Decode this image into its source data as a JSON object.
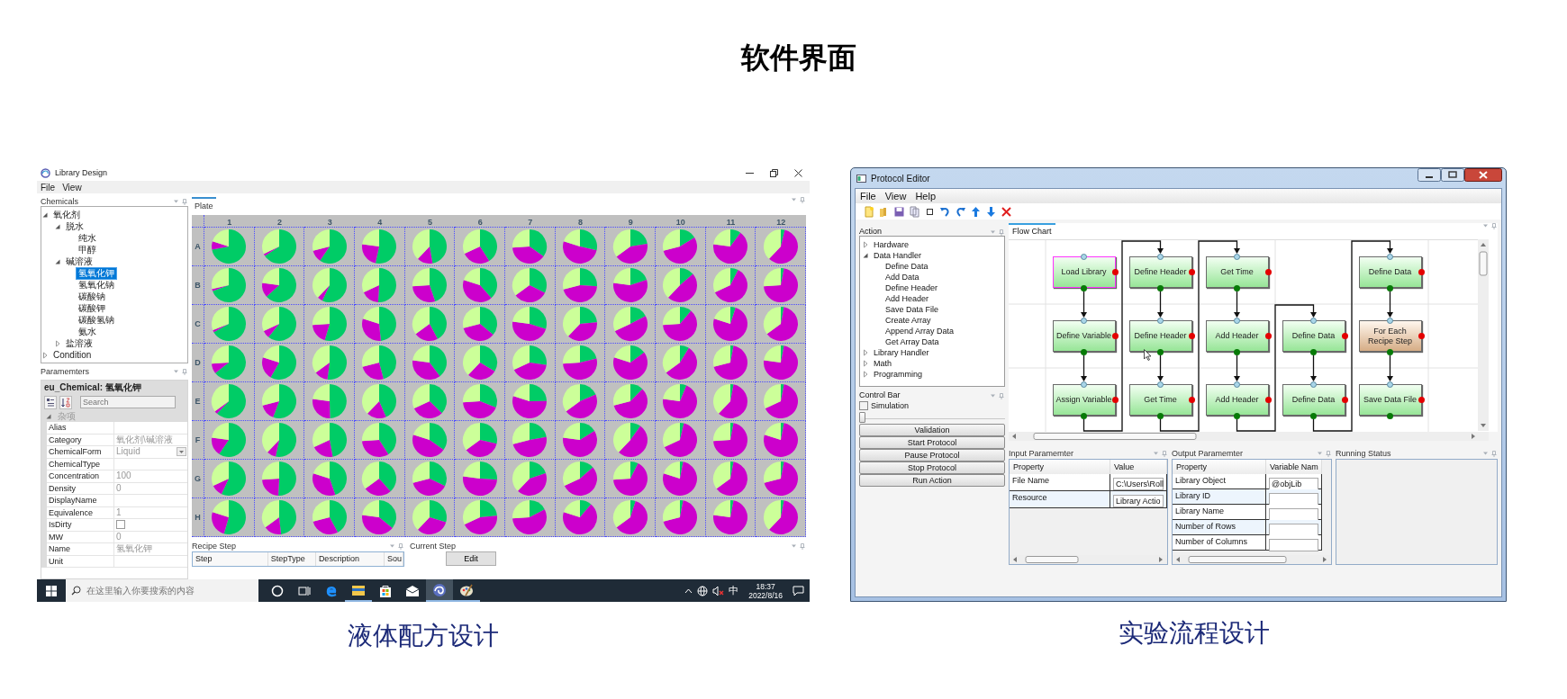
{
  "title": "软件界面",
  "library_design": {
    "window": {
      "title": "Library Design"
    },
    "menu": [
      "File",
      "View"
    ],
    "chemicals": {
      "title": "Chemicals",
      "tree": [
        {
          "label": "氧化剂",
          "expanded": true,
          "selected": false,
          "children": [
            {
              "label": "脱水",
              "expanded": true,
              "selected": false,
              "children": [
                {
                  "label": "纯水",
                  "selected": false
                },
                {
                  "label": "甲醇",
                  "selected": false
                }
              ]
            },
            {
              "label": "碱溶液",
              "expanded": true,
              "selected": false,
              "children": [
                {
                  "label": "氢氧化钾",
                  "selected": true
                },
                {
                  "label": "氢氧化钠",
                  "selected": false
                },
                {
                  "label": "碳酸钠",
                  "selected": false
                },
                {
                  "label": "碳酸钾",
                  "selected": false
                },
                {
                  "label": "碳酸氢钠",
                  "selected": false
                },
                {
                  "label": "氨水",
                  "selected": false
                }
              ]
            },
            {
              "label": "盐溶液",
              "expanded": false,
              "selected": false
            }
          ]
        },
        {
          "label": "Condition",
          "expanded": false,
          "selected": false
        }
      ]
    },
    "parameters": {
      "title": "Paramemters",
      "object": "eu_Chemical: 氢氧化钾",
      "search": {
        "placeholder": "Search"
      },
      "category": {
        "label": "杂项",
        "expanded": true
      },
      "rows": [
        {
          "name": "Alias",
          "kind": "text"
        },
        {
          "name": "Category",
          "kind": "text",
          "value": "氧化剂\\碱溶液"
        },
        {
          "name": "ChemicalForm",
          "kind": "dropdown",
          "value": "Liquid"
        },
        {
          "name": "ChemicalType",
          "kind": "text"
        },
        {
          "name": "Concentration",
          "kind": "text",
          "value": "100"
        },
        {
          "name": "Density",
          "kind": "text",
          "value": "0"
        },
        {
          "name": "DisplayName",
          "kind": "text"
        },
        {
          "name": "Equivalence",
          "kind": "text",
          "value": "1"
        },
        {
          "name": "IsDirty",
          "kind": "checkbox",
          "checked": false
        },
        {
          "name": "MW",
          "kind": "text",
          "value": "0"
        },
        {
          "name": "Name",
          "kind": "text",
          "value": "氢氧化钾"
        },
        {
          "name": "Unit",
          "kind": "text"
        }
      ]
    },
    "plate": {
      "tab": "Plate",
      "columns": [
        "1",
        "2",
        "3",
        "4",
        "5",
        "6",
        "7",
        "8",
        "9",
        "10",
        "11",
        "12"
      ],
      "rows": [
        "A",
        "B",
        "C",
        "D",
        "E",
        "F",
        "G",
        "H"
      ]
    },
    "recipe_step": {
      "title": "Recipe Step",
      "columns": [
        "Step",
        "StepType",
        "Description",
        "Sou"
      ]
    },
    "current_step": {
      "title": "Current Step",
      "button": "Edit"
    },
    "taskbar": {
      "search": {
        "placeholder": "在这里输入你要搜索的内容"
      },
      "apps": [
        {
          "kind": "cortana",
          "selected": false,
          "running": false
        },
        {
          "kind": "task-view",
          "selected": false,
          "running": false
        },
        {
          "kind": "browser",
          "selected": false,
          "running": false
        },
        {
          "kind": "folder",
          "selected": false,
          "running": true
        },
        {
          "kind": "store",
          "selected": false,
          "running": false
        },
        {
          "kind": "mail",
          "selected": false,
          "running": false
        },
        {
          "kind": "swirl",
          "selected": true,
          "running": true
        },
        {
          "kind": "paint",
          "selected": false,
          "running": true
        }
      ],
      "ime": "中",
      "time": "18:37",
      "date": "2022/8/16"
    },
    "caption": "液体配方设计"
  },
  "protocol_editor": {
    "window": {
      "title": "Protocol Editor"
    },
    "menu": [
      "File",
      "View",
      "Help"
    ],
    "action": {
      "title": "Action",
      "tree": [
        {
          "label": "Hardware",
          "expanded": false,
          "selected": false
        },
        {
          "label": "Data Handler",
          "expanded": true,
          "selected": false,
          "children": [
            {
              "label": "Define Data",
              "selected": false
            },
            {
              "label": "Add Data",
              "selected": false
            },
            {
              "label": "Define Header",
              "selected": false
            },
            {
              "label": "Add Header",
              "selected": false
            },
            {
              "label": "Save Data File",
              "selected": false
            },
            {
              "label": "Create Array",
              "selected": false
            },
            {
              "label": "Append Array Data",
              "selected": false
            },
            {
              "label": "Get Array Data",
              "selected": false
            }
          ]
        },
        {
          "label": "Library Handler",
          "expanded": false,
          "selected": false
        },
        {
          "label": "Math",
          "expanded": false,
          "selected": false
        },
        {
          "label": "Programming",
          "expanded": false,
          "selected": false
        }
      ]
    },
    "control_bar": {
      "title": "Control Bar",
      "simulation": {
        "label": "Simulation",
        "checked": false
      },
      "slider": {
        "level": 0
      },
      "buttons": [
        "Validation",
        "Start Protocol",
        "Pause Protocol",
        "Stop Protocol",
        "Run Action"
      ]
    },
    "flow_chart": {
      "tab": "Flow Chart",
      "columns": [
        {
          "nodes": [
            {
              "label": "Load Library",
              "kind": "action",
              "selected": true
            },
            {
              "label": "Define Variable",
              "kind": "action",
              "selected": false
            },
            {
              "label": "Assign Variable",
              "kind": "action",
              "selected": false
            }
          ]
        },
        {
          "nodes": [
            {
              "label": "Define Header",
              "kind": "action",
              "selected": false
            },
            {
              "label": "Define Header",
              "kind": "action",
              "selected": false
            },
            {
              "label": "Get Time",
              "kind": "action",
              "selected": false
            }
          ]
        },
        {
          "nodes": [
            {
              "label": "Get Time",
              "kind": "action",
              "selected": false
            },
            {
              "label": "Add Header",
              "kind": "action",
              "selected": false
            },
            {
              "label": "Add Header",
              "kind": "action",
              "selected": false
            }
          ]
        },
        {
          "nodes": [
            {
              "kind": "empty"
            },
            {
              "label": "Define Data",
              "kind": "action",
              "selected": false
            },
            {
              "label": "Define Data",
              "kind": "action",
              "selected": false
            }
          ]
        },
        {
          "nodes": [
            {
              "label": "Define Data",
              "kind": "action",
              "selected": false
            },
            {
              "label": "For Each Recipe Step",
              "kind": "loop",
              "selected": false
            },
            {
              "label": "Save Data File",
              "kind": "action",
              "selected": false
            }
          ]
        }
      ]
    },
    "input_parameter": {
      "title": "Input Paramemter",
      "columns": [
        "Property",
        "Value"
      ],
      "rows": [
        {
          "property": "File Name",
          "value": "C:\\Users\\Roll"
        },
        {
          "property": "Resource",
          "value": "Library Actio"
        }
      ]
    },
    "output_parameter": {
      "title": "Output Paramemter",
      "columns": [
        "Property",
        "Variable Nam"
      ],
      "rows": [
        {
          "property": "Library Object",
          "value": "@objLib"
        },
        {
          "property": "Library ID"
        },
        {
          "property": "Library Name"
        },
        {
          "property": "Number of Rows"
        },
        {
          "property": "Number of Columns"
        }
      ]
    },
    "running_status": {
      "title": "Running Status"
    },
    "caption": "实验流程设计"
  }
}
